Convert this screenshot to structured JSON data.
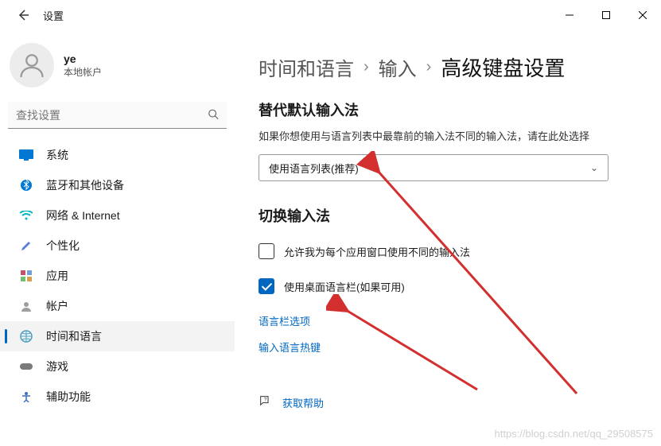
{
  "window": {
    "title": "设置",
    "min_tooltip": "最小化",
    "max_tooltip": "最大化",
    "close_tooltip": "关闭"
  },
  "profile": {
    "name": "ye",
    "subtitle": "本地帐户"
  },
  "search": {
    "placeholder": "查找设置"
  },
  "nav": [
    {
      "id": "system",
      "label": "系统",
      "icon_color": "#0078d4"
    },
    {
      "id": "bluetooth",
      "label": "蓝牙和其他设备",
      "icon_color": "#0078d4"
    },
    {
      "id": "network",
      "label": "网络 & Internet",
      "icon_color": "#00b7c3"
    },
    {
      "id": "personalization",
      "label": "个性化",
      "icon_color": "#5a7fd6"
    },
    {
      "id": "apps",
      "label": "应用",
      "icon_color": "#c44f6f"
    },
    {
      "id": "accounts",
      "label": "帐户",
      "icon_color": "#9e9e9e"
    },
    {
      "id": "time-language",
      "label": "时间和语言",
      "icon_color": "#4aa0bf",
      "active": true
    },
    {
      "id": "gaming",
      "label": "游戏",
      "icon_color": "#7a7a7a"
    },
    {
      "id": "accessibility",
      "label": "辅助功能",
      "icon_color": "#3a6fbf"
    }
  ],
  "breadcrumb": {
    "level1": "时间和语言",
    "level2": "输入",
    "current": "高级键盘设置"
  },
  "override": {
    "title": "替代默认输入法",
    "subtitle": "如果你想使用与语言列表中最靠前的输入法不同的输入法，请在此处选择",
    "selected": "使用语言列表(推荐)"
  },
  "switch": {
    "title": "切换输入法",
    "allow_per_app": "允许我为每个应用窗口使用不同的输入法",
    "allow_per_app_checked": false,
    "use_desktop_bar": "使用桌面语言栏(如果可用)",
    "use_desktop_bar_checked": true
  },
  "links": {
    "language_bar_options": "语言栏选项",
    "hotkeys": "输入语言热键",
    "get_help": "获取帮助"
  },
  "watermark": "https://blog.csdn.net/qq_29508575"
}
